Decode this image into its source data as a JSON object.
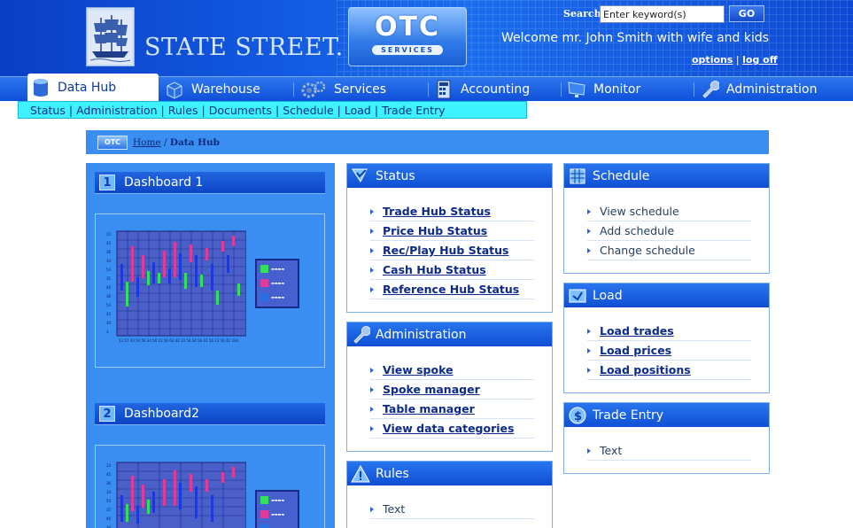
{
  "header": {
    "brand_name": "STATE STREET.",
    "otc_logo": {
      "big": "OTC",
      "small": "SERVICES"
    },
    "search": {
      "label": "Search",
      "placeholder": "Enter keyword(s)",
      "button": "GO"
    },
    "welcome": "Welcome mr. John Smith with wife and kids",
    "links": {
      "options": "options",
      "separator": "|",
      "logoff": "log off"
    },
    "colors": {
      "header_bg": "#1157e0",
      "active_tab_bg": "#ffffff",
      "subnav_bg": "#3ff2ff",
      "panel_bg": "#3a8ef2"
    }
  },
  "mainnav": {
    "items": [
      {
        "label": "Data Hub",
        "icon": "database-icon",
        "active": true
      },
      {
        "label": "Warehouse",
        "icon": "warehouse-cube-icon",
        "active": false
      },
      {
        "label": "Services",
        "icon": "gears-icon",
        "active": false
      },
      {
        "label": "Accounting",
        "icon": "calculator-icon",
        "active": false
      },
      {
        "label": "Monitor",
        "icon": "monitor-icon",
        "active": false
      },
      {
        "label": "Administration",
        "icon": "wrench-icon",
        "active": false
      }
    ]
  },
  "subnav": {
    "items": [
      "Status",
      "Administration",
      "Rules",
      "Documents",
      "Schedule",
      "Load",
      "Trade Entry"
    ],
    "separator": "|"
  },
  "breadcrumb": {
    "logo": "OTC",
    "home": "Home",
    "separator": "/",
    "current": "Data Hub"
  },
  "dashboards": [
    {
      "number": "1",
      "title": "Dashboard 1"
    },
    {
      "number": "2",
      "title": "Dashboard2"
    }
  ],
  "status": {
    "title": "Status",
    "icon": "status-icon",
    "links": [
      "Trade Hub Status",
      "Price Hub Status",
      "Rec/Play Hub Status",
      "Cash Hub Status",
      "Reference Hub Status"
    ]
  },
  "administration": {
    "title": "Administration",
    "icon": "wrench-icon",
    "links": [
      "View spoke",
      "Spoke manager",
      "Table manager",
      "View data categories"
    ]
  },
  "rules": {
    "title": "Rules",
    "icon": "warning-icon",
    "items": [
      "Text"
    ]
  },
  "schedule": {
    "title": "Schedule",
    "icon": "calendar-icon",
    "items": [
      "View schedule",
      "Add schedule",
      "Change schedule"
    ]
  },
  "load": {
    "title": "Load",
    "icon": "load-icon",
    "links": [
      "Load trades",
      "Load prices",
      "Load positions"
    ]
  },
  "trade_entry": {
    "title": "Trade Entry",
    "icon": "dollar-icon",
    "items": [
      "Text"
    ]
  }
}
